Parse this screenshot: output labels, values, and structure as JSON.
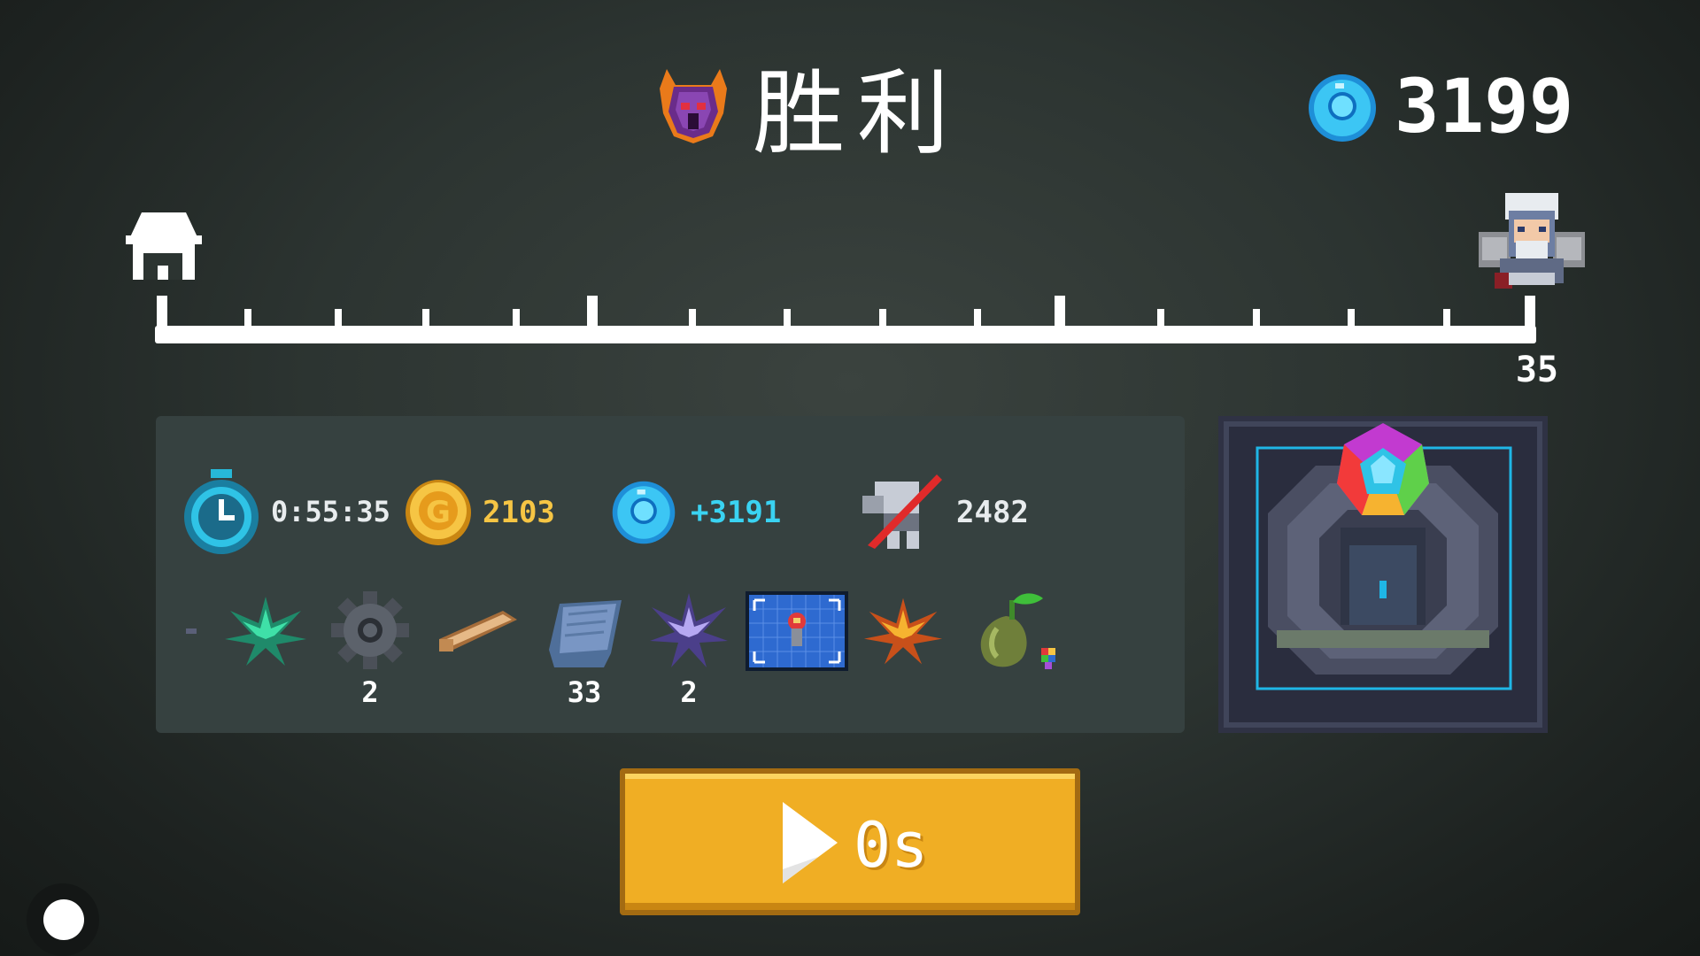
{
  "header": {
    "title": "胜利",
    "gem_total": "3199"
  },
  "progress": {
    "level": "35",
    "progress_fraction": 1.0
  },
  "stats": {
    "time": "0:55:35",
    "gold": "2103",
    "gems_gained": "+3191",
    "kills": "2482"
  },
  "drops": [
    {
      "icon": "green-leaf-icon",
      "count": ""
    },
    {
      "icon": "gear-icon",
      "count": "2"
    },
    {
      "icon": "wood-plank-icon",
      "count": ""
    },
    {
      "icon": "cloth-icon",
      "count": "33"
    },
    {
      "icon": "purple-crystal-icon",
      "count": "2"
    },
    {
      "icon": "blueprint-icon",
      "count": ""
    },
    {
      "icon": "orange-leaf-icon",
      "count": ""
    },
    {
      "icon": "seed-icon",
      "count": ""
    }
  ],
  "play_button": {
    "label": "0s"
  },
  "colors": {
    "accent_gold": "#f0ae24",
    "gold_text": "#f6c544",
    "gem_text": "#3ad3f2",
    "panel_bg": "#364140"
  }
}
